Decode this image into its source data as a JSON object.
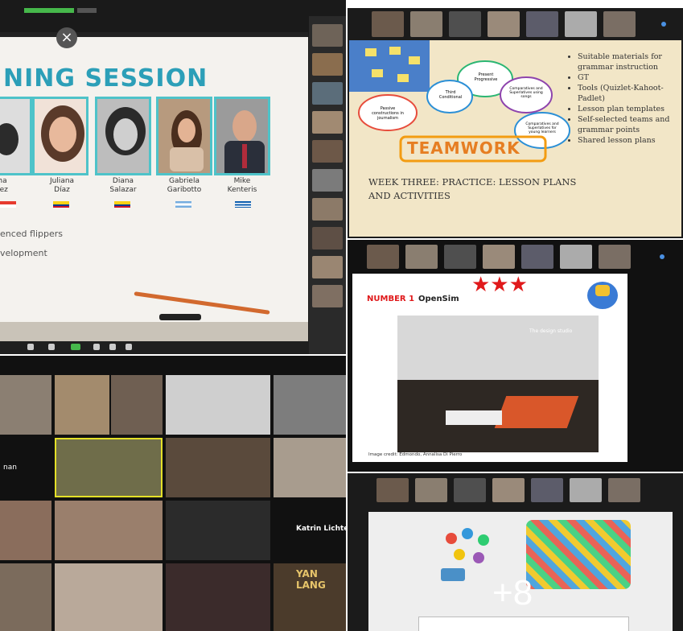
{
  "panel1": {
    "title": "NING SESSION",
    "participants": [
      {
        "first": "ha",
        "last": "rez"
      },
      {
        "first": "Juliana",
        "last": "Díaz"
      },
      {
        "first": "Diana",
        "last": "Salazar"
      },
      {
        "first": "Gabriela",
        "last": "Garibotto"
      },
      {
        "first": "Mike",
        "last": "Kenteris"
      }
    ],
    "bullets": [
      "enced flippers",
      "velopment"
    ],
    "close_glyph": "×"
  },
  "panel2": {
    "bubbles": [
      "Present Progressive",
      "Third Conditional",
      "Comparatives and Superlatives using songs",
      "Comparatives and Superlatives for young learners",
      "Passive constructions in journalism"
    ],
    "teamwork": "TEAMWORK",
    "week_title": "WEEK THREE: PRACTICE: LESSON PLANS AND ACTIVITIES",
    "bullet_list": [
      "Suitable materials for grammar instruction",
      "GT",
      "Tools (Quizlet-Kahoot-Padlet)",
      "Lesson plan templates",
      "Self-selected teams and grammar points",
      "Shared lesson plans"
    ]
  },
  "panel3": {
    "name_left": "nan",
    "name_right": "Katrin Lichterf",
    "sign_text": "YAN LANG"
  },
  "panel4": {
    "number": "NUMBER 1",
    "opensim": "OpenSim",
    "design_studio": "The design studio",
    "credit": "Image credit: Edmondo, Annalisa Di Pierro"
  },
  "panel5": {
    "more": "+8"
  },
  "colors": {
    "teal": "#2c9fb8",
    "slide_beige": "#f2e6c7",
    "red": "#e0191b"
  }
}
